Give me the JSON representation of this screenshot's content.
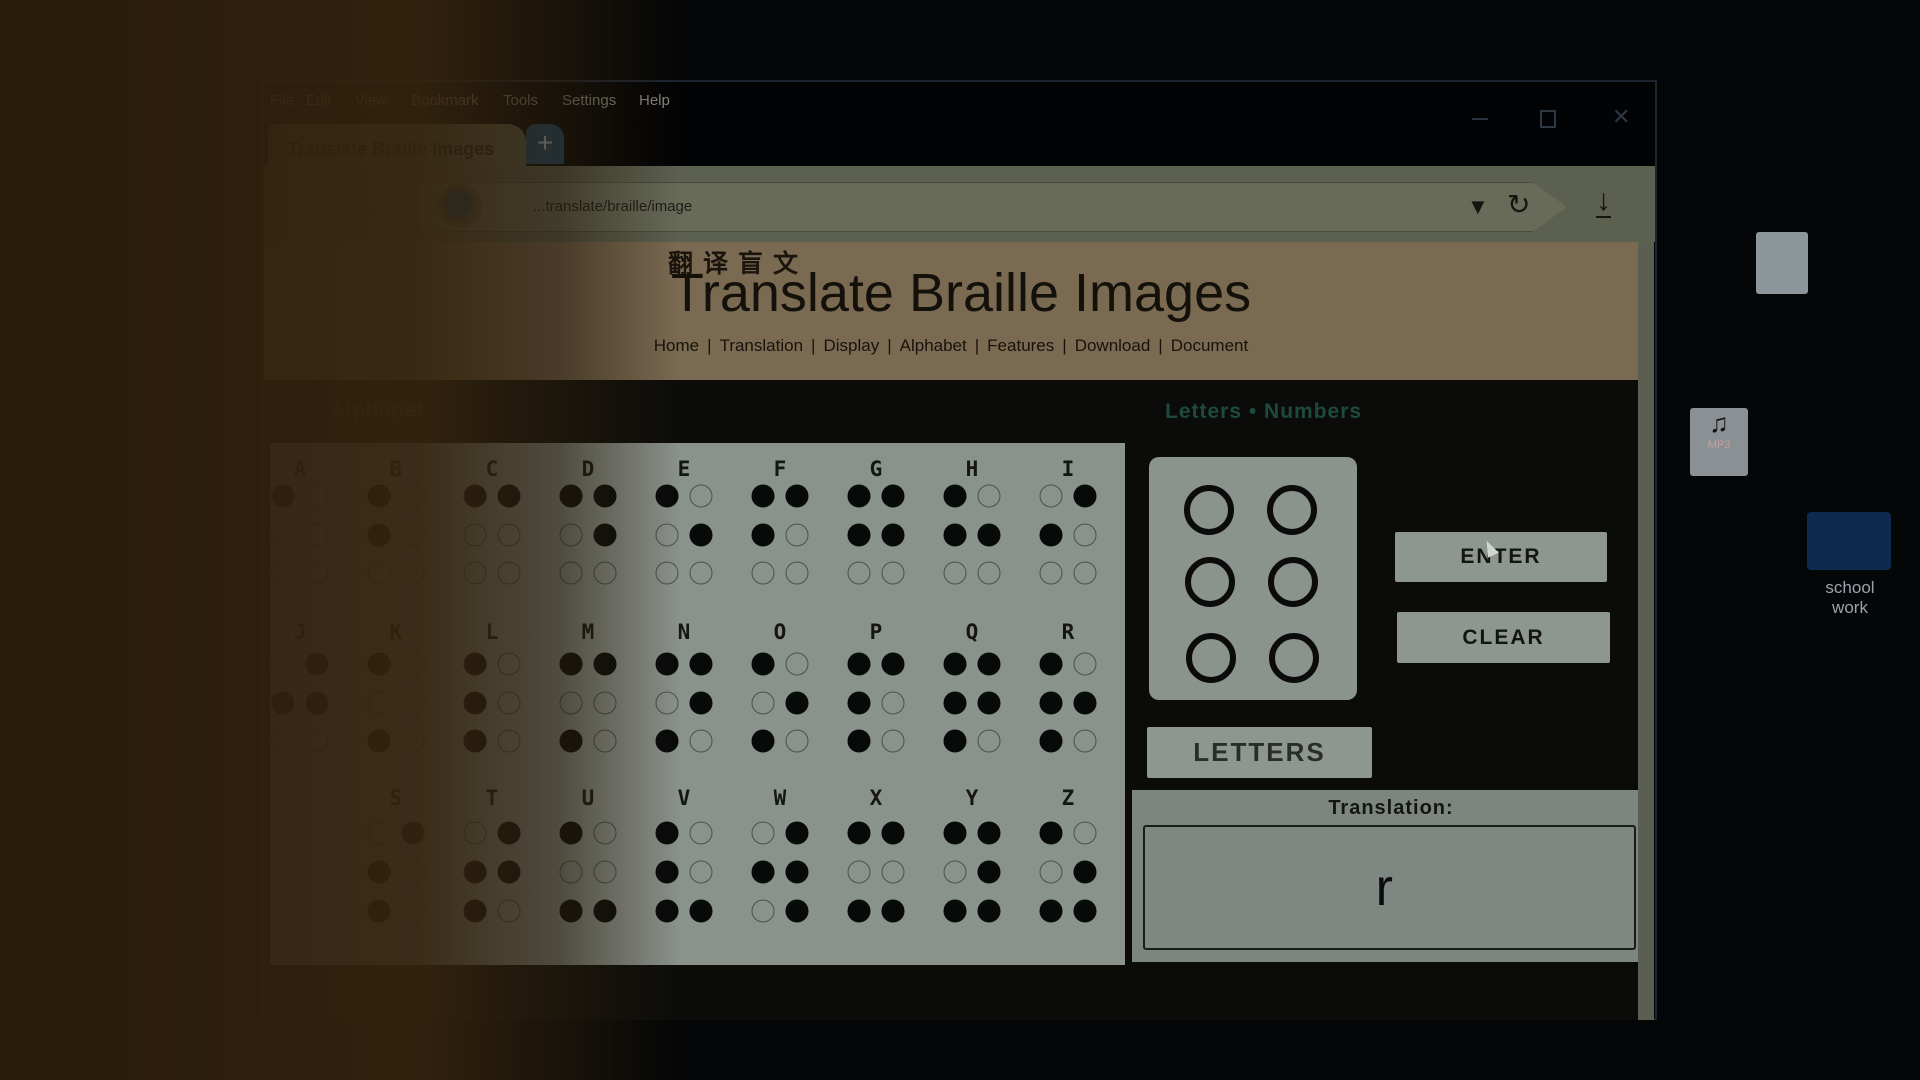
{
  "browser": {
    "menu": [
      "File",
      "Edit",
      "View",
      "Bookmark",
      "Tools",
      "Settings",
      "Help"
    ],
    "tab_title": "Translate Braille Images",
    "new_tab_label": "+",
    "url": "...translate/braille/image",
    "window_controls": [
      "minimize-icon",
      "maximize-icon",
      "close-icon"
    ]
  },
  "page": {
    "chinese_title": "翻译盲文",
    "title": "Translate Braille Images",
    "nav": [
      "Home",
      "Translation",
      "Display",
      "Alphabet",
      "Features",
      "Download",
      "Document"
    ],
    "alphabet_heading": "Alphabet",
    "mode_heading": "Letters • Numbers",
    "braille": [
      {
        "l": "A",
        "d": [
          1
        ]
      },
      {
        "l": "B",
        "d": [
          1,
          2
        ]
      },
      {
        "l": "C",
        "d": [
          1,
          4
        ]
      },
      {
        "l": "D",
        "d": [
          1,
          4,
          5
        ]
      },
      {
        "l": "E",
        "d": [
          1,
          5
        ]
      },
      {
        "l": "F",
        "d": [
          1,
          2,
          4
        ]
      },
      {
        "l": "G",
        "d": [
          1,
          2,
          4,
          5
        ]
      },
      {
        "l": "H",
        "d": [
          1,
          2,
          5
        ]
      },
      {
        "l": "I",
        "d": [
          2,
          4
        ]
      },
      {
        "l": "J",
        "d": [
          2,
          4,
          5
        ]
      },
      {
        "l": "K",
        "d": [
          1,
          3
        ]
      },
      {
        "l": "L",
        "d": [
          1,
          2,
          3
        ]
      },
      {
        "l": "M",
        "d": [
          1,
          3,
          4
        ]
      },
      {
        "l": "N",
        "d": [
          1,
          3,
          4,
          5
        ]
      },
      {
        "l": "O",
        "d": [
          1,
          3,
          5
        ]
      },
      {
        "l": "P",
        "d": [
          1,
          2,
          3,
          4
        ]
      },
      {
        "l": "Q",
        "d": [
          1,
          2,
          3,
          4,
          5
        ]
      },
      {
        "l": "R",
        "d": [
          1,
          2,
          3,
          5
        ]
      },
      {
        "l": "S",
        "d": [
          2,
          3,
          4
        ]
      },
      {
        "l": "T",
        "d": [
          2,
          3,
          4,
          5
        ]
      },
      {
        "l": "U",
        "d": [
          1,
          3,
          6
        ]
      },
      {
        "l": "V",
        "d": [
          1,
          2,
          3,
          6
        ]
      },
      {
        "l": "W",
        "d": [
          2,
          4,
          5,
          6
        ]
      },
      {
        "l": "X",
        "d": [
          1,
          3,
          4,
          6
        ]
      },
      {
        "l": "Y",
        "d": [
          1,
          3,
          4,
          5,
          6
        ]
      },
      {
        "l": "Z",
        "d": [
          1,
          3,
          5,
          6
        ]
      }
    ],
    "input_cell_dots_raised": [],
    "enter_label": "ENTER",
    "clear_label": "CLEAR",
    "mode_button_label": "LETTERS",
    "translation_label": "Translation:",
    "translation_value": "r"
  },
  "desktop": {
    "folder_label": "school work",
    "mp3_badge": "MP3"
  }
}
